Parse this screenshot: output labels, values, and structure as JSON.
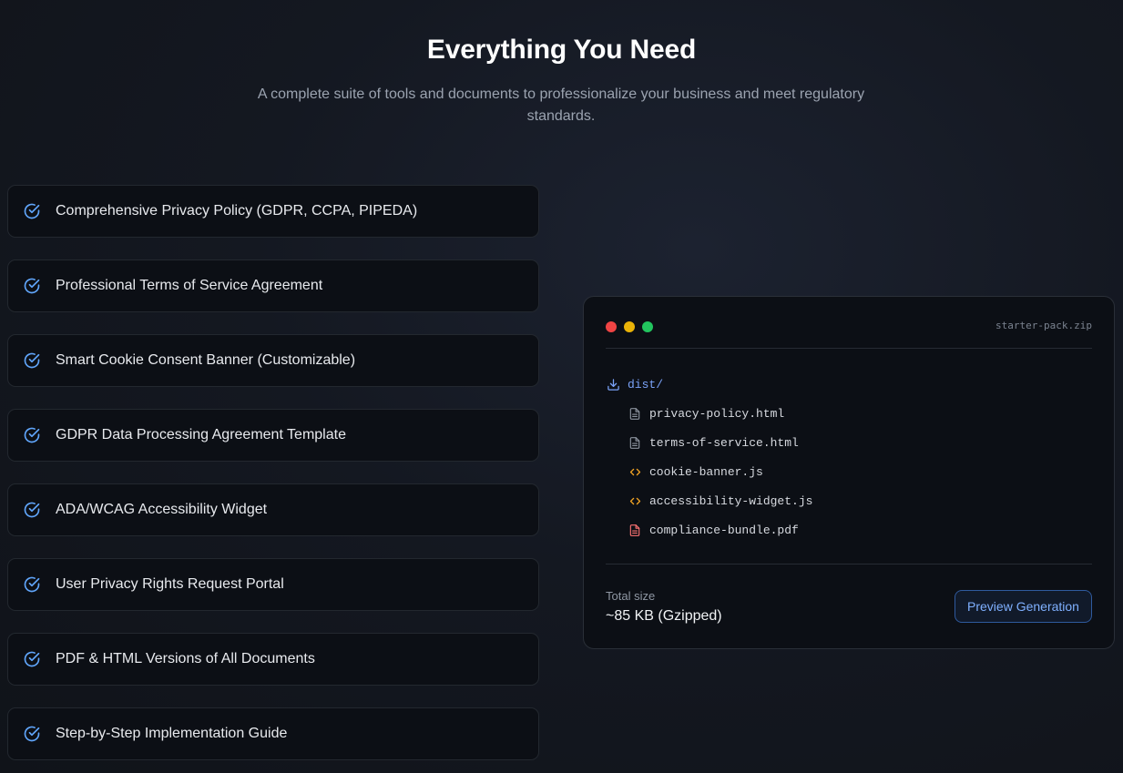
{
  "hero": {
    "title": "Everything You Need",
    "subtitle": "A complete suite of tools and documents to professionalize your business and meet regulatory standards."
  },
  "features": [
    {
      "label": "Comprehensive Privacy Policy (GDPR, CCPA, PIPEDA)",
      "icon": "check-circle-icon"
    },
    {
      "label": "Professional Terms of Service Agreement",
      "icon": "check-circle-icon"
    },
    {
      "label": "Smart Cookie Consent Banner (Customizable)",
      "icon": "check-circle-icon"
    },
    {
      "label": "GDPR Data Processing Agreement Template",
      "icon": "check-circle-icon"
    },
    {
      "label": "ADA/WCAG Accessibility Widget",
      "icon": "check-circle-icon"
    },
    {
      "label": "User Privacy Rights Request Portal",
      "icon": "check-circle-icon"
    },
    {
      "label": "PDF & HTML Versions of All Documents",
      "icon": "check-circle-icon"
    },
    {
      "label": "Step-by-Step Implementation Guide",
      "icon": "check-circle-icon"
    }
  ],
  "file_panel": {
    "archive_name": "starter-pack.zip",
    "folder": {
      "name": "dist/",
      "icon": "download-icon"
    },
    "files": [
      {
        "name": "privacy-policy.html",
        "icon": "file-icon"
      },
      {
        "name": "terms-of-service.html",
        "icon": "file-icon"
      },
      {
        "name": "cookie-banner.js",
        "icon": "code-icon"
      },
      {
        "name": "accessibility-widget.js",
        "icon": "code-icon"
      },
      {
        "name": "compliance-bundle.pdf",
        "icon": "pdf-file-icon"
      }
    ],
    "total_size_label": "Total size",
    "total_size_value": "~85 KB (Gzipped)",
    "preview_button": "Preview Generation"
  },
  "colors": {
    "accent": "#7aa2f7",
    "check": "#60a5fa",
    "code_icon": "#f5a524",
    "pdf_icon": "#f87171",
    "window_red": "#ef4444",
    "window_yellow": "#eab308",
    "window_green": "#22c55e"
  }
}
